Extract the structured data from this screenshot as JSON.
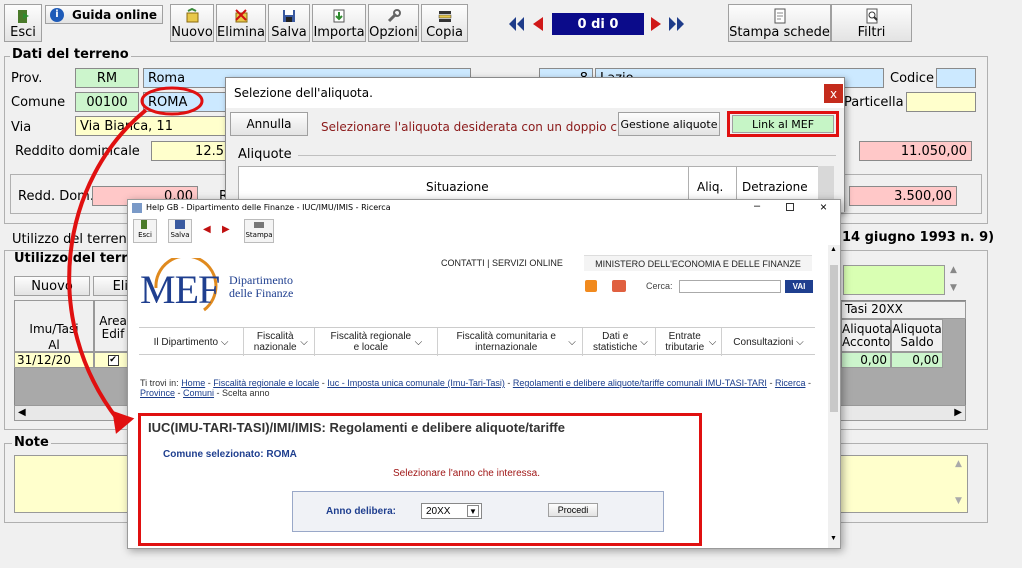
{
  "toolbar": {
    "exit": "Esci",
    "guide": "Guida online",
    "new": "Nuovo",
    "delete": "Elimina",
    "save": "Salva",
    "import": "Importa",
    "options": "Opzioni",
    "copy": "Copia",
    "record_counter": "0 di 0",
    "print": "Stampa schede",
    "filters": "Filtri"
  },
  "terrain": {
    "title": "Dati del terreno",
    "prov_label": "Prov.",
    "prov_code": "RM",
    "prov_name": "Roma",
    "region_code": "8",
    "region_name": "Lazio",
    "comune_label": "Comune",
    "comune_code": "00100",
    "comune_name": "ROMA",
    "via_label": "Via",
    "via_value": "Via Bianca, 11",
    "codice_label": "Codice",
    "particella_label": "Particella",
    "reddito_label": "Reddito dominicale",
    "reddito_value": "12.5",
    "value_right_1": "11.050,00",
    "redd_dom_label": "Redd. Dom.",
    "redd_dom_value": "0,00",
    "value_right_2": "3.500,00"
  },
  "usage": {
    "header_left": "Utilizzo del terreno",
    "header_right": "14 giugno 1993 n. 9)",
    "inner_title": "Utilizzo del terre",
    "new_btn": "Nuovo",
    "del_btn": "Eli",
    "col_imu": "Imu/Tasi",
    "col_al": "Al",
    "col_area": "Area",
    "col_edif": "Edif",
    "row_date": "31/12/20",
    "tasi_header": "Tasi 20XX",
    "col_acconto": "Aliquota Acconto",
    "col_saldo": "Aliquota Saldo",
    "val_acconto": "0,00",
    "val_saldo": "0,00"
  },
  "notes": {
    "title": "Note"
  },
  "dialog": {
    "title": "Selezione dell'aliquota.",
    "cancel": "Annulla",
    "instruction": "Selezionare l'aliquota desiderata con un doppio click",
    "manage": "Gestione aliquote",
    "link_mef": "Link al MEF",
    "group_title": "Aliquote",
    "col_situazione": "Situazione",
    "col_aliq": "Aliq.",
    "col_detrazione": "Detrazione"
  },
  "mef_window": {
    "title": "Help GB - Dipartimento delle Finanze - IUC/IMU/IMIS - Ricerca",
    "tb_exit": "Esci",
    "tb_save": "Salva",
    "tb_print": "Stampa",
    "logo": "MEF",
    "dept_line1": "Dipartimento",
    "dept_line2": "delle Finanze",
    "top_links": "CONTATTI | SERVIZI ONLINE",
    "ministry": "MINISTERO DELL'ECONOMIA E DELLE FINANZE",
    "search_label": "Cerca:",
    "search_btn": "VAI",
    "menu": [
      "Il Dipartimento",
      "Fiscalità nazionale",
      "Fiscalità regionale e locale",
      "Fiscalità comunitaria e internazionale",
      "Dati e statistiche",
      "Entrate tributarie",
      "Consultazioni"
    ],
    "breadcrumb_prefix": "Ti trovi in:",
    "breadcrumb_links": [
      "Home",
      "Fiscalità regionale e locale",
      "Iuc - Imposta unica comunale (Imu-Tari-Tasi)",
      "Regolamenti e delibere aliquote/tariffe comunali IMU-TASI-TARI",
      "Ricerca",
      "Province",
      "Comuni"
    ],
    "breadcrumb_current": "Scelta anno",
    "section_title": "IUC(IMU-TARI-TASI)/IMI/IMIS: Regolamenti e delibere aliquote/tariffe",
    "comune_selected": "Comune selezionato: ROMA",
    "select_year": "Selezionare l'anno che interessa.",
    "year_label": "Anno delibera:",
    "year_value": "20XX",
    "proceed": "Procedi"
  }
}
